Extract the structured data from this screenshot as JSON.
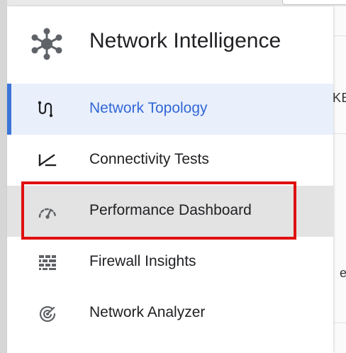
{
  "header": {
    "product_title": "Network Intelligence",
    "logo_icon": "network-hub-icon"
  },
  "nav": {
    "items": [
      {
        "label": "Network Topology",
        "icon": "topology-icon",
        "state": "selected"
      },
      {
        "label": "Connectivity Tests",
        "icon": "connectivity-test-icon",
        "state": "default"
      },
      {
        "label": "Performance Dashboard",
        "icon": "gauge-icon",
        "state": "hovered"
      },
      {
        "label": "Firewall Insights",
        "icon": "firewall-icon",
        "state": "default"
      },
      {
        "label": "Network Analyzer",
        "icon": "radar-icon",
        "state": "default"
      }
    ]
  },
  "background_page": {
    "fragment_top": "KE",
    "fragment_middle": "eli"
  },
  "colors": {
    "accent": "#3d74d8",
    "selected_text": "#3367d6",
    "selected_bg": "#e9f0fc",
    "hover_bg": "#e3e3e3",
    "highlight": "#e01010",
    "icon": "#5f6368"
  }
}
